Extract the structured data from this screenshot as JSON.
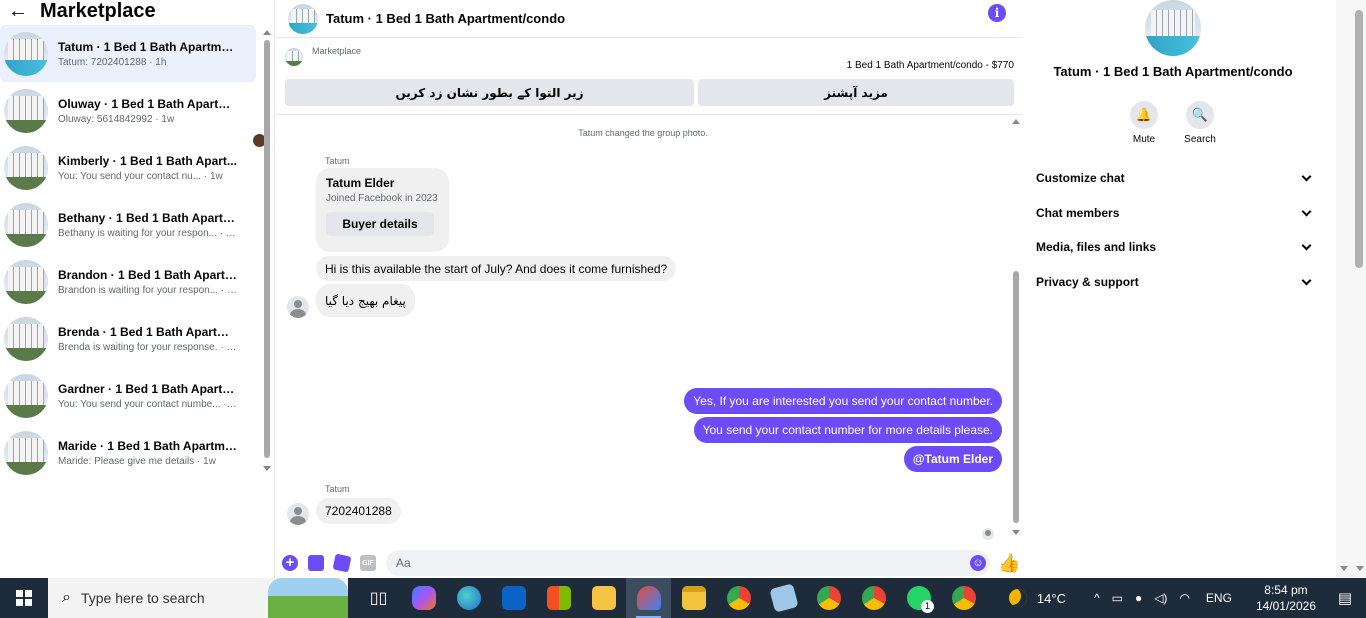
{
  "sidebar": {
    "title": "Marketplace",
    "conversations": [
      {
        "name": "Tatum · 1 Bed 1 Bath Apartment...",
        "preview": "Tatum: 7202401288 · 1h",
        "active": true
      },
      {
        "name": "Oluway · 1 Bed 1 Bath Apartmen...",
        "preview": "Oluway: 5614842992 · 1w"
      },
      {
        "name": "Kimberly · 1 Bed 1 Bath Apart...",
        "preview": "You: You send your contact nu... · 1w"
      },
      {
        "name": "Bethany · 1 Bed 1 Bath Apartme...",
        "preview": "Bethany is waiting for your respon... · 1w"
      },
      {
        "name": "Brandon · 1 Bed 1 Bath Apartme...",
        "preview": "Brandon is waiting for your respon... · 1w"
      },
      {
        "name": "Brenda · 1 Bed 1 Bath Apartmen...",
        "preview": "Brenda is waiting for your response. · 1w"
      },
      {
        "name": "Gardner · 1 Bed 1 Bath Apartme...",
        "preview": "You: You send your contact numbe... · 1w"
      },
      {
        "name": "Maride · 1 Bed 1 Bath Apartmen...",
        "preview": "Maride: Please give me details · 1w"
      }
    ]
  },
  "chat": {
    "title": "Tatum · 1 Bed 1 Bath Apartment/condo",
    "marketplace_label": "Marketplace",
    "listing": "1 Bed 1 Bath Apartment/condo - $770",
    "btn_mark_pending": "زیر التوا کے بطور نشان زد کریں",
    "btn_more_options": "مزید آپشنز",
    "system_message": "Tatum changed the group photo.",
    "sender_name": "Tatum",
    "card": {
      "name": "Tatum Elder",
      "sub": "Joined Facebook in 2023",
      "button": "Buyer details"
    },
    "incoming_1": "Hi is this available the start of July? And does it come furnished?",
    "incoming_2": "پیغام بھیج دیا گیا",
    "outgoing_1": "Yes, If you are interested you send your contact number.",
    "outgoing_2": "You send your contact number for more details please.",
    "outgoing_3": "@Tatum Elder",
    "incoming_3": "7202401288",
    "composer_placeholder": "Aa",
    "gif_label": "GIF"
  },
  "panel": {
    "title": "Tatum · 1 Bed 1 Bath Apartment/condo",
    "mute_label": "Mute",
    "search_label": "Search",
    "sections": [
      "Customize chat",
      "Chat members",
      "Media, files and links",
      "Privacy & support"
    ]
  },
  "taskbar": {
    "search_placeholder": "Type here to search",
    "badge_count": "1",
    "temperature": "14°C",
    "language": "ENG",
    "time": "8:54 pm",
    "date": "14/01/2026"
  },
  "colors": {
    "accent": "#6b4cf6",
    "bubble_in": "#f0f0f0",
    "taskbar": "#1d2b3a"
  },
  "icons": [
    "back-arrow-icon",
    "info-icon",
    "bell-icon",
    "search-icon",
    "chevron-down-icon",
    "plus-icon",
    "photo-icon",
    "sticker-icon",
    "gif-icon",
    "emoji-icon",
    "thumbs-up-icon",
    "windows-icon"
  ]
}
